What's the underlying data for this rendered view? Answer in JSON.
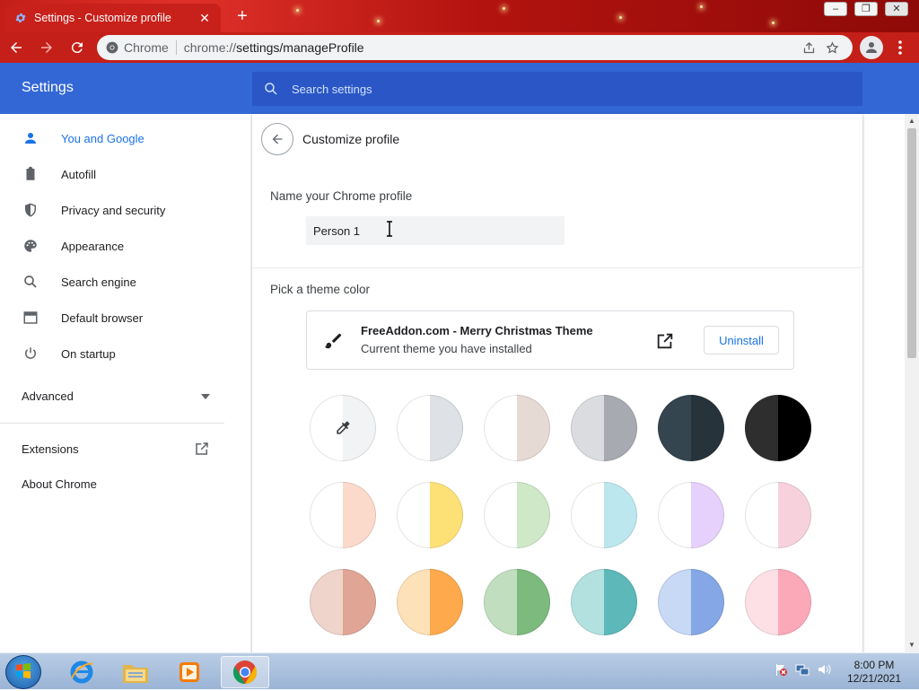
{
  "tab": {
    "title": "Settings - Customize profile",
    "close_glyph": "✕",
    "new_tab_glyph": "+"
  },
  "window_controls": {
    "minimize": "–",
    "restore": "❐",
    "close": "✕"
  },
  "omnibox": {
    "chip": "Chrome",
    "url_host": "chrome://",
    "url_path": "settings/manageProfile"
  },
  "settings": {
    "title": "Settings",
    "search_placeholder": "Search settings",
    "nav": [
      {
        "label": "You and Google",
        "icon": "person-icon",
        "active": true
      },
      {
        "label": "Autofill",
        "icon": "clipboard-icon"
      },
      {
        "label": "Privacy and security",
        "icon": "shield-icon"
      },
      {
        "label": "Appearance",
        "icon": "palette-icon"
      },
      {
        "label": "Search engine",
        "icon": "search-icon"
      },
      {
        "label": "Default browser",
        "icon": "browser-window-icon"
      },
      {
        "label": "On startup",
        "icon": "power-icon"
      }
    ],
    "advanced": "Advanced",
    "extensions": "Extensions",
    "about": "About Chrome"
  },
  "main": {
    "page_title": "Customize profile",
    "name_section": "Name your Chrome profile",
    "profile_name": "Person 1",
    "theme_section": "Pick a theme color",
    "theme": {
      "name": "FreeAddon.com - Merry Christmas Theme",
      "subtitle": "Current theme you have installed",
      "uninstall": "Uninstall"
    },
    "swatches": [
      [
        "#ffffff",
        "#f1f3f4"
      ],
      [
        "#ffffff",
        "#dee1e6"
      ],
      [
        "#ffffff",
        "#e6dad5"
      ],
      [
        "#dadce0",
        "#a8aab1"
      ],
      [
        "#35454f",
        "#27333b"
      ],
      [
        "#2e2e2e",
        "#000000"
      ],
      [
        "#ffffff",
        "#fcdacb"
      ],
      [
        "#ffffff",
        "#fde177"
      ],
      [
        "#ffffff",
        "#cfe8c8"
      ],
      [
        "#ffffff",
        "#bde7ee"
      ],
      [
        "#ffffff",
        "#e5d1fb"
      ],
      [
        "#ffffff",
        "#f7d2dc"
      ],
      [
        "#efd4cc",
        "#e0a594"
      ],
      [
        "#fde1b8",
        "#fda94c"
      ],
      [
        "#c1dfbf",
        "#7cba7d"
      ],
      [
        "#b3e1e0",
        "#5cb8b9"
      ],
      [
        "#c8d9f6",
        "#85a7e5"
      ],
      [
        "#fde0e6",
        "#fba8b8"
      ]
    ]
  },
  "taskbar": {
    "time": "8:00 PM",
    "date": "12/21/2021"
  },
  "colors": {
    "header": "#3367d6",
    "accent": "#1a73e8",
    "frame": "#c41f18"
  }
}
